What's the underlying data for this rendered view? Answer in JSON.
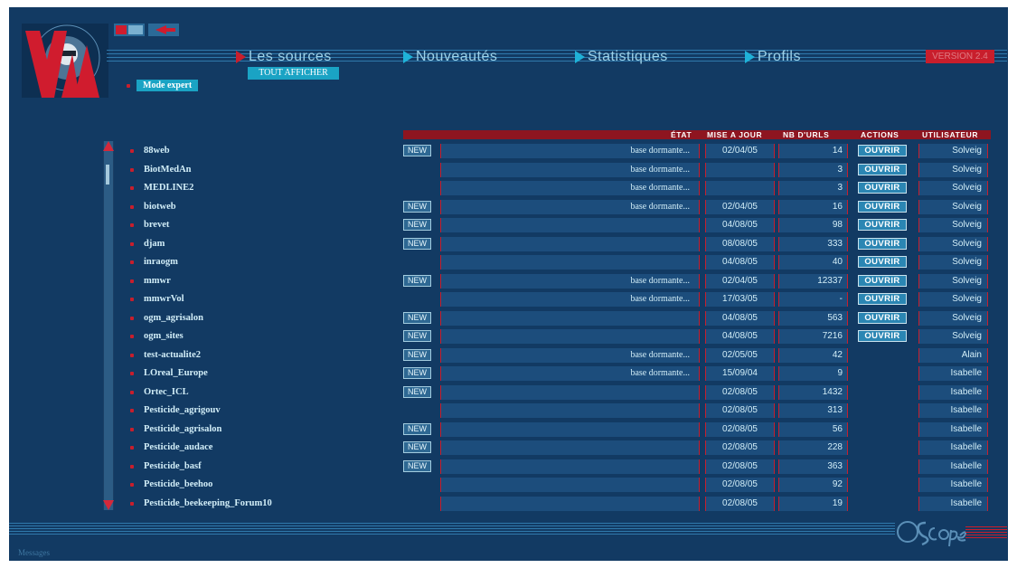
{
  "header": {
    "version": "VERSION 2.4",
    "tout_afficher": "TOUT AFFICHER",
    "mode_expert": "Mode expert",
    "nav": [
      {
        "label": "Les sources",
        "active": true
      },
      {
        "label": "Nouveautés",
        "active": false
      },
      {
        "label": "Statistiques",
        "active": false
      },
      {
        "label": "Profils",
        "active": false
      }
    ]
  },
  "columns": {
    "etat": "ÉTAT",
    "mise_a_jour": "MISE A JOUR",
    "nb_urls": "NB D'URLS",
    "actions": "ACTIONS",
    "utilisateur": "UTILISATEUR"
  },
  "new_label": "NEW",
  "ouvrir_label": "OUVRIR",
  "rows": [
    {
      "name": "88web",
      "is_new": true,
      "etat": "base dormante...",
      "date": "02/04/05",
      "urls": "14",
      "ouvrir": true,
      "user": "Solveig"
    },
    {
      "name": "BiotMedAn",
      "is_new": false,
      "etat": "base dormante...",
      "date": "",
      "urls": "3",
      "ouvrir": true,
      "user": "Solveig"
    },
    {
      "name": "MEDLINE2",
      "is_new": false,
      "etat": "base dormante...",
      "date": "",
      "urls": "3",
      "ouvrir": true,
      "user": "Solveig"
    },
    {
      "name": "biotweb",
      "is_new": true,
      "etat": "base dormante...",
      "date": "02/04/05",
      "urls": "16",
      "ouvrir": true,
      "user": "Solveig"
    },
    {
      "name": "brevet",
      "is_new": true,
      "etat": "",
      "date": "04/08/05",
      "urls": "98",
      "ouvrir": true,
      "user": "Solveig"
    },
    {
      "name": "djam",
      "is_new": true,
      "etat": "",
      "date": "08/08/05",
      "urls": "333",
      "ouvrir": true,
      "user": "Solveig"
    },
    {
      "name": "inraogm",
      "is_new": false,
      "etat": "",
      "date": "04/08/05",
      "urls": "40",
      "ouvrir": true,
      "user": "Solveig"
    },
    {
      "name": "mmwr",
      "is_new": true,
      "etat": "base dormante...",
      "date": "02/04/05",
      "urls": "12337",
      "ouvrir": true,
      "user": "Solveig"
    },
    {
      "name": "mmwrVol",
      "is_new": false,
      "etat": "base dormante...",
      "date": "17/03/05",
      "urls": "-",
      "ouvrir": true,
      "user": "Solveig"
    },
    {
      "name": "ogm_agrisalon",
      "is_new": true,
      "etat": "",
      "date": "04/08/05",
      "urls": "563",
      "ouvrir": true,
      "user": "Solveig"
    },
    {
      "name": "ogm_sites",
      "is_new": true,
      "etat": "",
      "date": "04/08/05",
      "urls": "7216",
      "ouvrir": true,
      "user": "Solveig"
    },
    {
      "name": "test-actualite2",
      "is_new": true,
      "etat": "base dormante...",
      "date": "02/05/05",
      "urls": "42",
      "ouvrir": false,
      "user": "Alain"
    },
    {
      "name": "LOreal_Europe",
      "is_new": true,
      "etat": "base dormante...",
      "date": "15/09/04",
      "urls": "9",
      "ouvrir": false,
      "user": "Isabelle"
    },
    {
      "name": "Ortec_ICL",
      "is_new": true,
      "etat": "",
      "date": "02/08/05",
      "urls": "1432",
      "ouvrir": false,
      "user": "Isabelle"
    },
    {
      "name": "Pesticide_agrigouv",
      "is_new": false,
      "etat": "",
      "date": "02/08/05",
      "urls": "313",
      "ouvrir": false,
      "user": "Isabelle"
    },
    {
      "name": "Pesticide_agrisalon",
      "is_new": true,
      "etat": "",
      "date": "02/08/05",
      "urls": "56",
      "ouvrir": false,
      "user": "Isabelle"
    },
    {
      "name": "Pesticide_audace",
      "is_new": true,
      "etat": "",
      "date": "02/08/05",
      "urls": "228",
      "ouvrir": false,
      "user": "Isabelle"
    },
    {
      "name": "Pesticide_basf",
      "is_new": true,
      "etat": "",
      "date": "02/08/05",
      "urls": "363",
      "ouvrir": false,
      "user": "Isabelle"
    },
    {
      "name": "Pesticide_beehoo",
      "is_new": false,
      "etat": "",
      "date": "02/08/05",
      "urls": "92",
      "ouvrir": false,
      "user": "Isabelle"
    },
    {
      "name": "Pesticide_beekeeping_Forum10",
      "is_new": false,
      "etat": "",
      "date": "02/08/05",
      "urls": "19",
      "ouvrir": false,
      "user": "Isabelle"
    }
  ],
  "footer": {
    "messages": "Messages"
  },
  "icons": {
    "logo": "kw-logo-icon",
    "footer_logo": "scope-logo-icon"
  },
  "colors": {
    "background": "#123a63",
    "accent_red": "#c81e2c",
    "accent_cyan": "#1aa3c4"
  }
}
